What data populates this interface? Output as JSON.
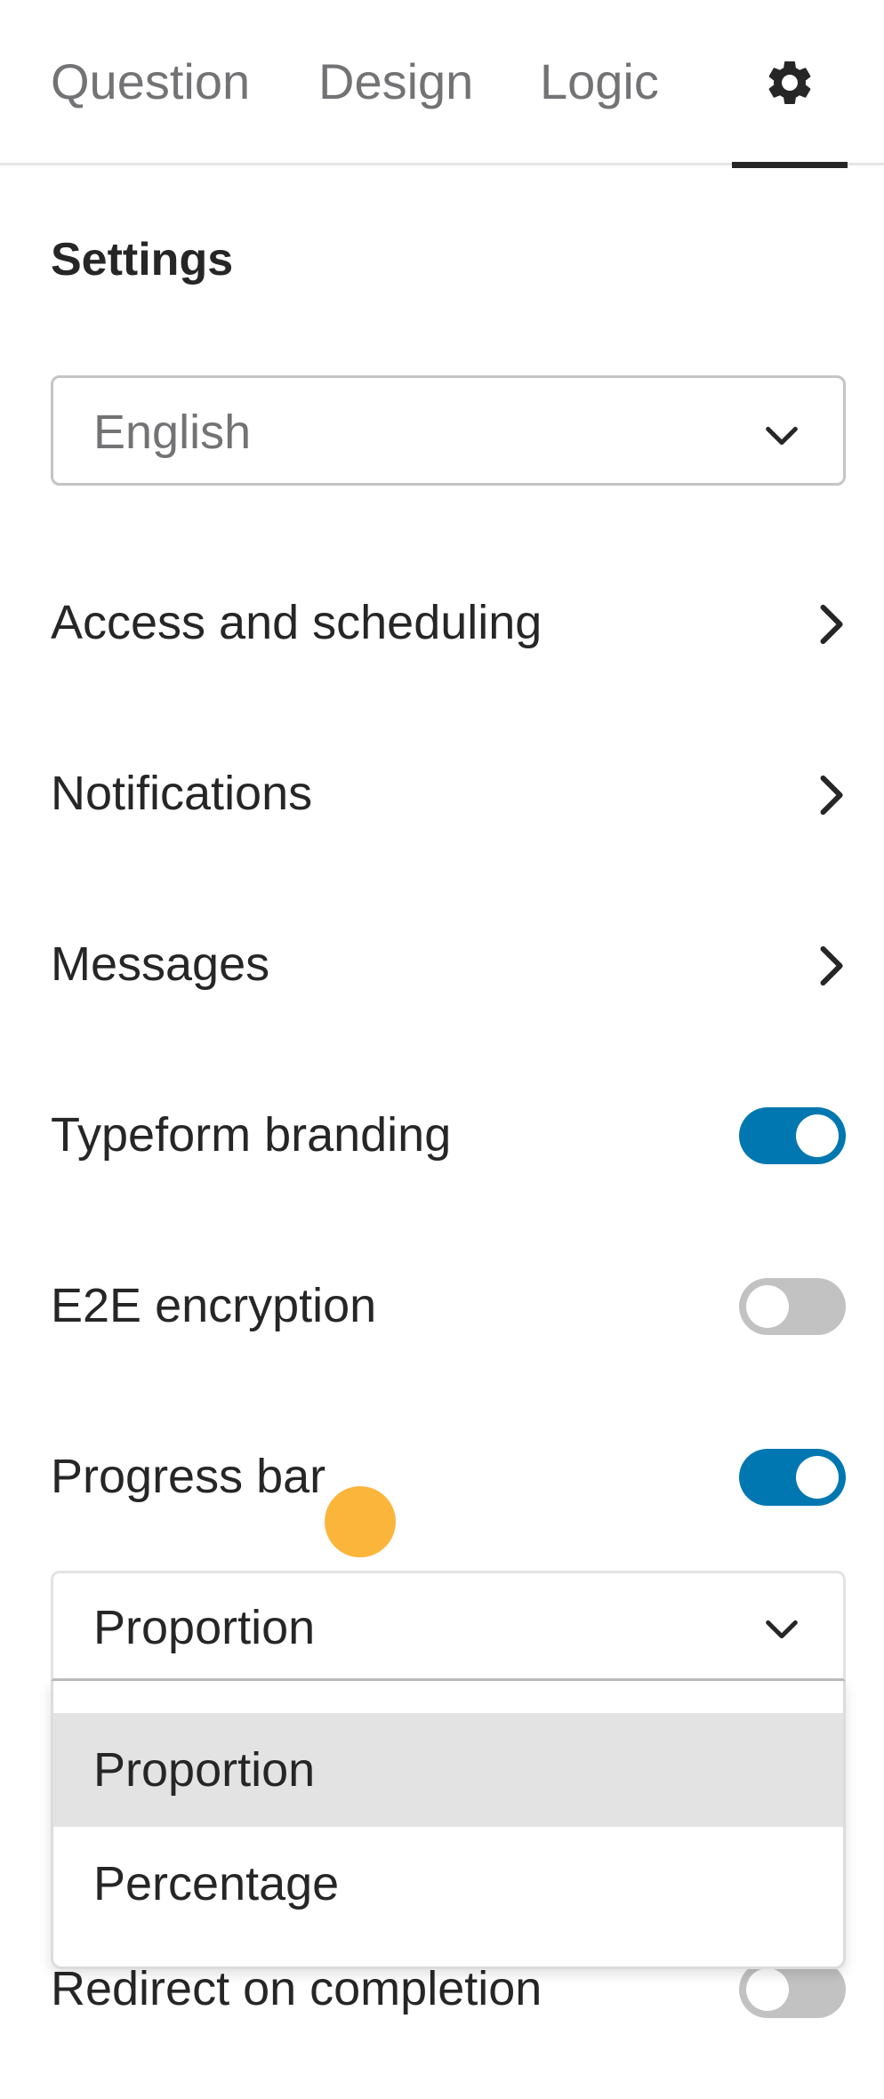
{
  "tabs": {
    "question": "Question",
    "design": "Design",
    "logic": "Logic",
    "settings_icon": "gear-icon",
    "active": "settings"
  },
  "settings": {
    "title": "Settings",
    "language": {
      "value": "English",
      "icon": "chevron-down-icon"
    },
    "nav_rows": [
      {
        "label": "Access and scheduling",
        "icon": "chevron-right-icon"
      },
      {
        "label": "Notifications",
        "icon": "chevron-right-icon"
      },
      {
        "label": "Messages",
        "icon": "chevron-right-icon"
      }
    ],
    "toggles": [
      {
        "label": "Typeform branding",
        "on": true
      },
      {
        "label": "E2E encryption",
        "on": false
      },
      {
        "label": "Progress bar",
        "on": true
      }
    ],
    "progress_bar_select": {
      "value": "Proportion",
      "icon": "chevron-down-icon",
      "options": [
        {
          "label": "Proportion",
          "selected": true
        },
        {
          "label": "Percentage",
          "selected": false
        }
      ]
    },
    "redirect_toggle": {
      "label": "Redirect on completion",
      "on": false
    }
  },
  "colors": {
    "toggle_on": "#0077b0",
    "toggle_off": "#c2c2c2",
    "text": "#262627",
    "muted_text": "#737376",
    "touch_indicator": "#fbb53b"
  }
}
